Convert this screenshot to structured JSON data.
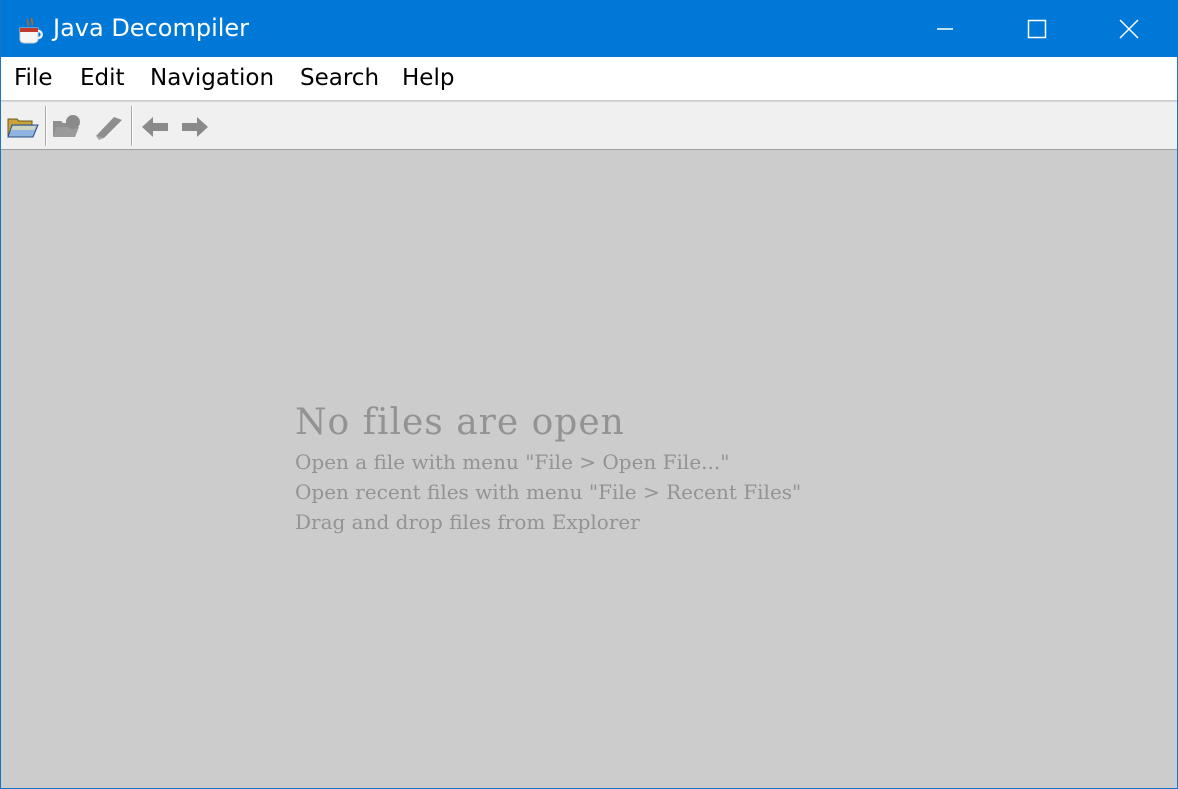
{
  "window": {
    "title": "Java Decompiler",
    "accent": "#0078d7"
  },
  "menubar": {
    "items": [
      "File",
      "Edit",
      "Navigation",
      "Search",
      "Help"
    ]
  },
  "toolbar": {
    "buttons": [
      {
        "icon": "open-folder-icon",
        "enabled": true
      },
      {
        "icon": "save-disabled-icon",
        "enabled": false
      },
      {
        "icon": "search-disabled-icon",
        "enabled": false
      },
      {
        "icon": "back-arrow-icon",
        "enabled": false
      },
      {
        "icon": "forward-arrow-icon",
        "enabled": false
      }
    ]
  },
  "empty_state": {
    "title": "No files are open",
    "lines": [
      "Open a file with menu \"File > Open File...\"",
      "Open recent files with menu \"File > Recent Files\"",
      "Drag and drop files from Explorer"
    ]
  }
}
